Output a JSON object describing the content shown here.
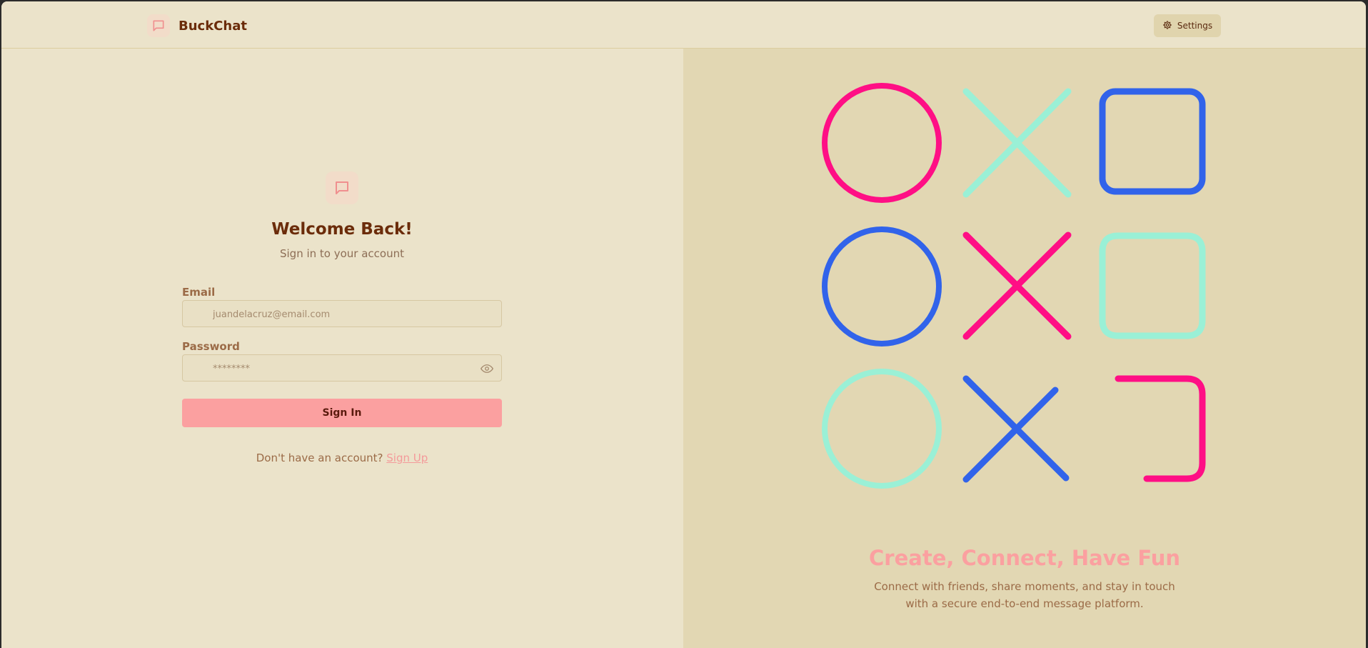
{
  "brand": {
    "name": "BuckChat",
    "logo_icon": "chat-bubble-icon"
  },
  "header": {
    "settings_label": "Settings",
    "settings_icon": "gear-icon"
  },
  "login": {
    "title": "Welcome Back!",
    "subtitle": "Sign in to your account",
    "email_label": "Email",
    "email_placeholder": "juandelacruz@email.com",
    "password_label": "Password",
    "password_placeholder": "********",
    "signin_label": "Sign In",
    "signup_prompt": "Don't have an account?",
    "signup_link": "Sign Up"
  },
  "hero": {
    "shapes": [
      {
        "shape": "circle",
        "color": "#ff0f85"
      },
      {
        "shape": "cross",
        "color": "#9af0d6"
      },
      {
        "shape": "square",
        "color": "#3163ea"
      },
      {
        "shape": "circle",
        "color": "#3163ea"
      },
      {
        "shape": "cross",
        "color": "#ff0f85"
      },
      {
        "shape": "square",
        "color": "#9af0d6"
      },
      {
        "shape": "circle",
        "color": "#9af0d6"
      },
      {
        "shape": "cross",
        "color": "#3163ea"
      },
      {
        "shape": "square",
        "color": "#ff0f85"
      }
    ],
    "title": "Create, Connect, Have Fun",
    "description": "Connect with friends, share moments, and stay in touch with a secure end-to-end message platform."
  },
  "colors": {
    "pink": "#ff0f85",
    "mint": "#9af0d6",
    "blue": "#3163ea",
    "accent": "#fba0a0",
    "brown": "#6b2c0a"
  }
}
